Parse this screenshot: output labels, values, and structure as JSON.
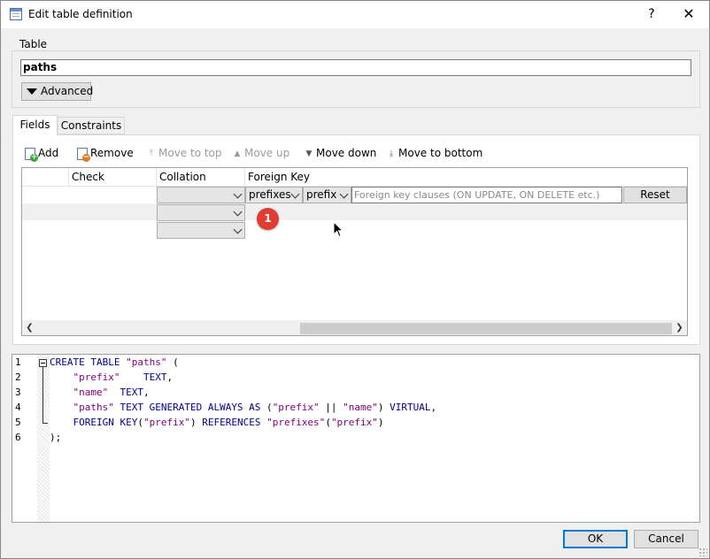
{
  "window": {
    "title": "Edit table definition",
    "help": "?",
    "close": "✕"
  },
  "table_group": {
    "label": "Table",
    "name_value": "paths",
    "advanced_label": "Advanced"
  },
  "tabs": [
    {
      "label": "Fields",
      "active": true
    },
    {
      "label": "Constraints",
      "active": false
    }
  ],
  "toolbar": {
    "add": "Add",
    "remove": "Remove",
    "move_top": "Move to top",
    "move_up": "Move up",
    "move_down": "Move down",
    "move_bottom": "Move to bottom"
  },
  "grid": {
    "columns": [
      "",
      "Check",
      "Collation",
      "Foreign Key"
    ],
    "rows": [
      {
        "collation": "",
        "fk_table": "prefixes",
        "fk_column": "prefix",
        "fk_clause_placeholder": "Foreign key clauses (ON UPDATE, ON DELETE etc.)",
        "reset": "Reset"
      },
      {
        "collation": ""
      },
      {
        "collation": ""
      }
    ]
  },
  "badge": "1",
  "editor": {
    "line_numbers": [
      "1",
      "2",
      "3",
      "4",
      "5",
      "6"
    ]
  },
  "buttons": {
    "ok": "OK",
    "cancel": "Cancel"
  },
  "colors": {
    "keyword": "#00008b",
    "string": "#800080",
    "badge": "#e03c31",
    "accent": "#0078d7"
  }
}
